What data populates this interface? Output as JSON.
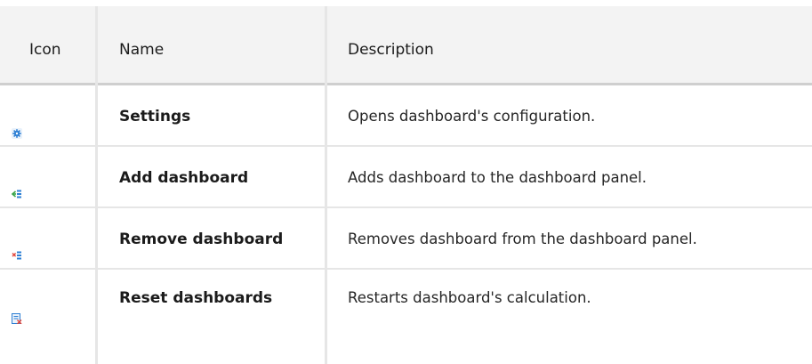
{
  "table": {
    "headers": {
      "icon": "Icon",
      "name": "Name",
      "description": "Description"
    },
    "rows": [
      {
        "icon": "gear-icon",
        "name": "Settings",
        "description": "Opens dashboard's configuration."
      },
      {
        "icon": "add-dashboard-icon",
        "name": "Add dashboard",
        "description": "Adds dashboard to the dashboard panel."
      },
      {
        "icon": "remove-dashboard-icon",
        "name": "Remove dashboard",
        "description": "Removes dashboard from the dashboard panel."
      },
      {
        "icon": "reset-dashboards-icon",
        "name": "Reset dashboards",
        "description": "Restarts dashboard's calculation."
      }
    ],
    "colors": {
      "header_bg": "#f3f3f3",
      "icon_blue": "#2f80d4",
      "icon_green": "#3aa54a",
      "icon_red": "#e2483d"
    }
  }
}
